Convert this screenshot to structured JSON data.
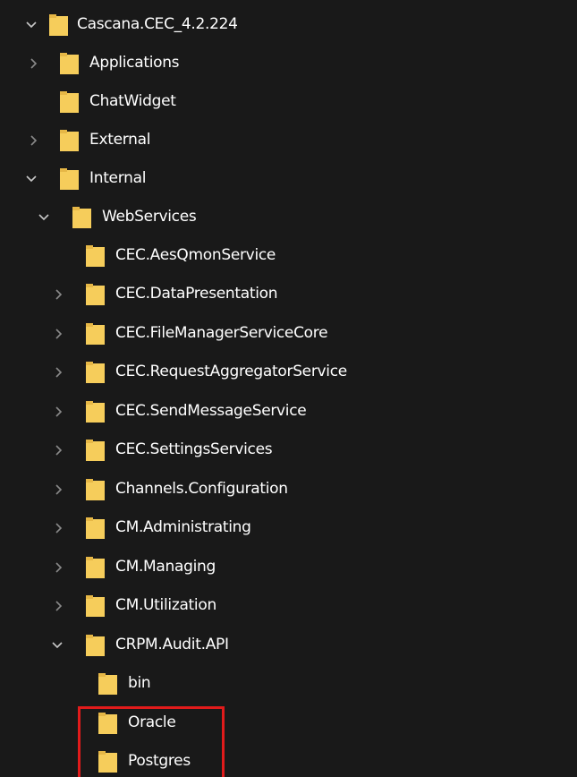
{
  "tree": {
    "items": [
      {
        "label": "Cascana.CEC_4.2.224",
        "expanded": true,
        "has_children": true
      },
      {
        "label": "Applications",
        "expanded": false,
        "has_children": true
      },
      {
        "label": "ChatWidget",
        "expanded": false,
        "has_children": false
      },
      {
        "label": "External",
        "expanded": false,
        "has_children": true
      },
      {
        "label": "Internal",
        "expanded": true,
        "has_children": true
      },
      {
        "label": "WebServices",
        "expanded": true,
        "has_children": true
      },
      {
        "label": "CEC.AesQmonService",
        "expanded": false,
        "has_children": false
      },
      {
        "label": "CEC.DataPresentation",
        "expanded": false,
        "has_children": true
      },
      {
        "label": "CEC.FileManagerServiceCore",
        "expanded": false,
        "has_children": true
      },
      {
        "label": "CEC.RequestAggregatorService",
        "expanded": false,
        "has_children": true
      },
      {
        "label": "CEC.SendMessageService",
        "expanded": false,
        "has_children": true
      },
      {
        "label": "CEC.SettingsServices",
        "expanded": false,
        "has_children": true
      },
      {
        "label": "Channels.Configuration",
        "expanded": false,
        "has_children": true
      },
      {
        "label": "CM.Administrating",
        "expanded": false,
        "has_children": true
      },
      {
        "label": "CM.Managing",
        "expanded": false,
        "has_children": true
      },
      {
        "label": "CM.Utilization",
        "expanded": false,
        "has_children": true
      },
      {
        "label": "CRPM.Audit.API",
        "expanded": true,
        "has_children": true
      },
      {
        "label": "bin",
        "expanded": false,
        "has_children": false
      },
      {
        "label": "Oracle",
        "expanded": false,
        "has_children": false
      },
      {
        "label": "Postgres",
        "expanded": false,
        "has_children": false
      }
    ]
  },
  "colors": {
    "background": "#191919",
    "text": "#ffffff",
    "chevron": "#8a8a8a",
    "chevron_expanded": "#c8c8c8",
    "folder": "#f6cd5b",
    "folder_tab": "#e6b746",
    "highlight": "#e11b1b"
  },
  "icons": {
    "folder": "folder-icon",
    "collapsed": "chevron-right-icon",
    "expanded": "chevron-down-icon"
  }
}
